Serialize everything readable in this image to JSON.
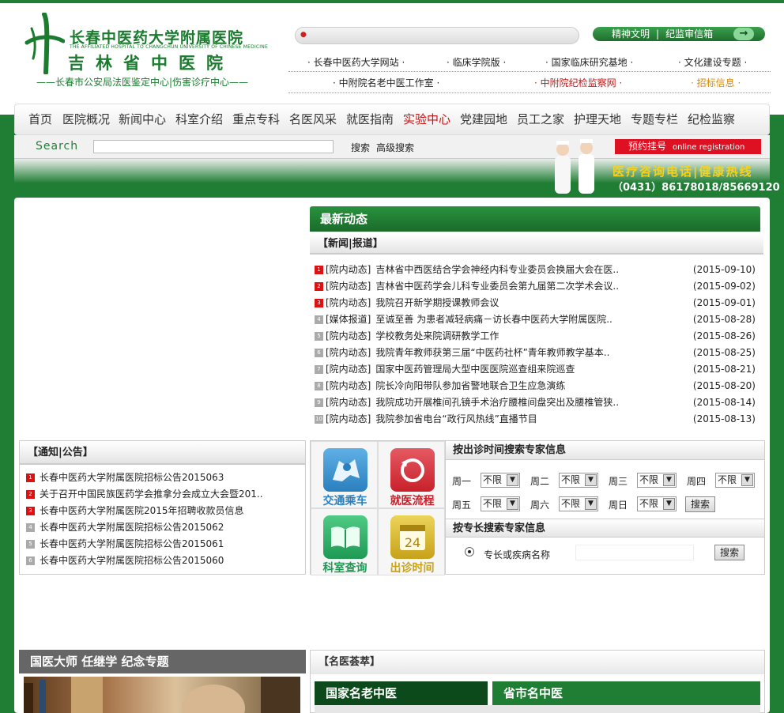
{
  "header": {
    "hospital_name": "长春中医药大学附属医院",
    "hospital_english": "THE AFFILIATED HOSPITAL TO CHANGCHUN UNIVERSITY OF CHINESE MEDICINE",
    "hospital_name2": "吉林省中医院",
    "slogan": "——长春市公安局法医鉴定中心|伤害诊疗中心——",
    "quick_links": {
      "left": "精神文明",
      "sep": "|",
      "right": "纪监审信箱",
      "arrow": "→"
    },
    "site_links_row1": [
      "· 长春中医药大学网站 ·",
      "· 临床学院版 ·",
      "· 国家临床研究基地 ·",
      "· 文化建设专题 ·"
    ],
    "site_links_row2": [
      "· 中附院名老中医工作室 ·",
      "· 中附院纪检监察网 ·",
      "· 招标信息 ·"
    ]
  },
  "nav": {
    "items": [
      "首页",
      "医院概况",
      "新闻中心",
      "科室介绍",
      "重点专科",
      "名医风采",
      "就医指南",
      "实验中心",
      "党建园地",
      "员工之家",
      "护理天地",
      "专题专栏",
      "纪检监察"
    ],
    "highlight_color": "#cc1111"
  },
  "search": {
    "label": "Search",
    "search_button": "搜索",
    "advanced_button": "高级搜索",
    "register_label": "预约挂号",
    "register_en": "online registration"
  },
  "banner": {
    "hotline_title": "医疗咨询电话|健康热线",
    "phone": "（0431）86178018/85669120"
  },
  "news": {
    "title": "最新动态",
    "subtitle": "【新闻|报道】",
    "items": [
      {
        "num": "1",
        "cat": "[院内动态]",
        "title": "吉林省中西医结合学会神经内科专业委员会换届大会在医..",
        "date": "(2015-09-10)"
      },
      {
        "num": "2",
        "cat": "[院内动态]",
        "title": "吉林省中医药学会儿科专业委员会第九届第二次学术会议..",
        "date": "(2015-09-02)"
      },
      {
        "num": "3",
        "cat": "[院内动态]",
        "title": "我院召开新学期授课教师会议",
        "date": "(2015-09-01)"
      },
      {
        "num": "4",
        "cat": "[媒体报道]",
        "title": "至诚至善 为患者减轻病痛－访长春中医药大学附属医院..",
        "date": "(2015-08-28)"
      },
      {
        "num": "5",
        "cat": "[院内动态]",
        "title": "学校教务处来院调研教学工作",
        "date": "(2015-08-26)"
      },
      {
        "num": "6",
        "cat": "[院内动态]",
        "title": "我院青年教师获第三届“中医药社杯”青年教师教学基本..",
        "date": "(2015-08-25)"
      },
      {
        "num": "7",
        "cat": "[院内动态]",
        "title": "国家中医药管理局大型中医医院巡查组来院巡查",
        "date": "(2015-08-21)"
      },
      {
        "num": "8",
        "cat": "[院内动态]",
        "title": "院长冷向阳带队参加省警地联合卫生应急演练",
        "date": "(2015-08-20)"
      },
      {
        "num": "9",
        "cat": "[院内动态]",
        "title": "我院成功开展椎间孔镜手术治疗腰椎间盘突出及腰椎管狭..",
        "date": "(2015-08-14)"
      },
      {
        "num": "10",
        "cat": "[院内动态]",
        "title": "我院参加省电台“政行风热线”直播节目",
        "date": "(2015-08-13)"
      }
    ]
  },
  "notice": {
    "title": "【通知|公告】",
    "items": [
      {
        "num": "1",
        "text": "长春中医药大学附属医院招标公告2015063"
      },
      {
        "num": "2",
        "text": "关于召开中国民族医药学会推拿分会成立大会暨201.."
      },
      {
        "num": "3",
        "text": "长春中医药大学附属医院2015年招聘收款员信息"
      },
      {
        "num": "4",
        "text": "长春中医药大学附属医院招标公告2015062"
      },
      {
        "num": "5",
        "text": "长春中医药大学附属医院招标公告2015061"
      },
      {
        "num": "6",
        "text": "长春中医药大学附属医院招标公告2015060"
      }
    ]
  },
  "tiles": [
    {
      "label": "交通乘车",
      "color": "#2a7fbd"
    },
    {
      "label": "就医流程",
      "color": "#c8202a"
    },
    {
      "label": "科室查询",
      "color": "#1f9a55"
    },
    {
      "label": "出诊时间",
      "color": "#c7a21a"
    }
  ],
  "expert_search": {
    "by_time_title": "按出诊时间搜索专家信息",
    "days": [
      "周一",
      "周二",
      "周三",
      "周四",
      "周五",
      "周六",
      "周日"
    ],
    "default_option": "不限",
    "search_button": "搜索",
    "by_specialty_title": "按专长搜索专家信息",
    "keyword_label": "专长或疾病名称",
    "search_button2": "搜索"
  },
  "master": {
    "title": "国医大师  任继学  纪念专题"
  },
  "doctors": {
    "title": "【名医荟萃】",
    "tab1": "国家名老中医",
    "tab2": "省市名中医"
  }
}
